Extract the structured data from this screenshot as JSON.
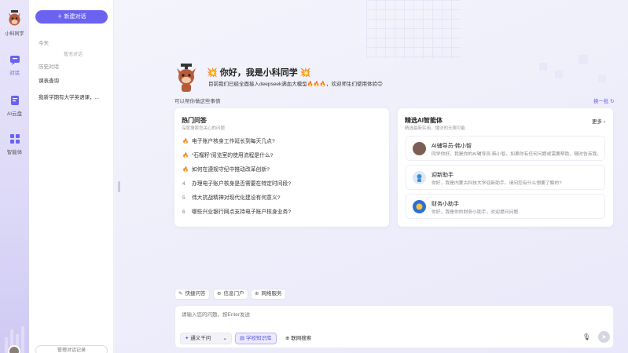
{
  "rail": {
    "app_name": "小科同学",
    "items": [
      {
        "label": "对话",
        "icon": "chat-icon"
      },
      {
        "label": "AI云盘",
        "icon": "cloud-drive-icon"
      },
      {
        "label": "智能体",
        "icon": "agent-grid-icon"
      }
    ]
  },
  "sidebar": {
    "new_chat_label": "新建对话",
    "today_label": "今天",
    "empty_label": "暂无对话",
    "history_label": "历史对话",
    "history_items": [
      "课表查询",
      "我新学期有大学英语课，..."
    ],
    "bottom_label": "管理对话记录"
  },
  "hero": {
    "title": "你好，我是小科同学",
    "title_emoji_left": "💥",
    "title_emoji_right": "💥",
    "subtitle": "目前我们已经全面接入deepseek满血大模型🔥🔥🔥，欢迎师生们使用体验😊"
  },
  "hint": "可以帮你做这些事情",
  "refresh_label": "换一批 ↻",
  "hot": {
    "title": "热门问答",
    "subtitle": "深度搜索您关心的问题",
    "items": [
      {
        "rank": "1",
        "text": "电子账户核身工作延长到每天几点?"
      },
      {
        "rank": "2",
        "text": "“石榴籽”阅览室的使用流程是什么?"
      },
      {
        "rank": "3",
        "text": "如何在遵规守纪中推动改革创新?"
      },
      {
        "rank": "4",
        "text": "办理电子账户核身是否需要在特定时间段?"
      },
      {
        "rank": "5",
        "text": "伟大抗战精神对现代化建设有何意义?"
      },
      {
        "rank": "6",
        "text": "哪些兴业银行网点支持电子账户核身业务?"
      }
    ]
  },
  "agents": {
    "title": "精选AI智能体",
    "subtitle": "精选最新实用、懂法的无限可能",
    "more_label": "更多 ›",
    "items": [
      {
        "name": "AI辅导员-韩小智",
        "desc": "同学你好，我是你的AI辅导员-韩小智，如果你有任何问题或需要帮助，随时告诉我，我会..."
      },
      {
        "name": "迎新助手",
        "desc": "你好，我是内蒙古科技大学迎新助手，请问您有什么想要了解的?"
      },
      {
        "name": "财务小助手",
        "desc": "你好，我是你的财务小助手，欢迎提问问题"
      }
    ]
  },
  "chips": [
    {
      "label": "快捷问答",
      "icon": "magic-wand-icon"
    },
    {
      "label": "信息门户",
      "icon": "portal-icon"
    },
    {
      "label": "网络服务",
      "icon": "network-icon"
    }
  ],
  "input": {
    "placeholder": "请输入您的问题，按Enter发送",
    "model_label": "通义千问",
    "kb_label": "学校知识库",
    "web_label": "联网搜索"
  },
  "colors": {
    "accent": "#6b63ef",
    "hot_rank": "#e2452f"
  }
}
